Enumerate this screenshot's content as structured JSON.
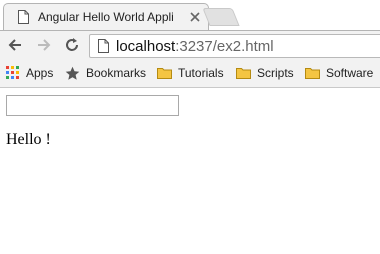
{
  "tab": {
    "title": "Angular Hello World Appli",
    "favicon": "page-icon",
    "close": "close-icon"
  },
  "toolbar": {
    "back": "back-arrow-icon",
    "forward": "forward-arrow-icon",
    "reload": "reload-icon",
    "url_host": "localhost",
    "url_path": ":3237/ex2.html"
  },
  "bookmarks": [
    {
      "label": "Apps",
      "icon": "apps-grid-icon"
    },
    {
      "label": "Bookmarks",
      "icon": "star-icon"
    },
    {
      "label": "Tutorials",
      "icon": "folder-icon"
    },
    {
      "label": "Scripts",
      "icon": "folder-icon"
    },
    {
      "label": "Software",
      "icon": "folder-icon"
    }
  ],
  "page": {
    "input_value": "",
    "greeting": "Hello !"
  },
  "colors": {
    "folder": "#f4c542",
    "apps_red": "#e94235",
    "apps_yellow": "#fabb05",
    "apps_green": "#34a853",
    "apps_blue": "#4285f4"
  }
}
